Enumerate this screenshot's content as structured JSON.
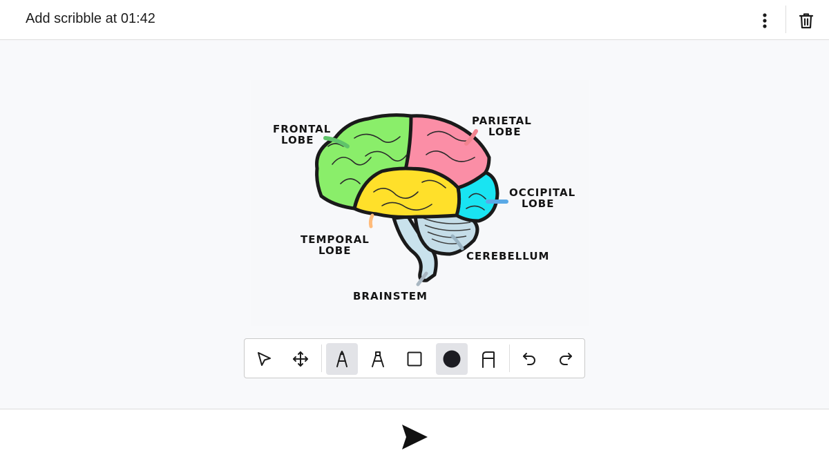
{
  "header": {
    "title": "Add scribble at 01:42",
    "more_icon": "vertical-dots-icon",
    "delete_icon": "trash-icon"
  },
  "image": {
    "labels": {
      "frontal_line1": "FRONTAL",
      "frontal_line2": "LOBE",
      "parietal_line1": "PARIETAL",
      "parietal_line2": "LOBE",
      "occipital_line1": "OCCIPITAL",
      "occipital_line2": "LOBE",
      "temporal_line1": "TEMPORAL",
      "temporal_line2": "LOBE",
      "cerebellum": "CEREBELLUM",
      "brainstem": "BRAINSTEM"
    },
    "colors": {
      "frontal": "#8aee6a",
      "parietal": "#fb8ea6",
      "occipital": "#19e4f2",
      "temporal": "#ffe02a",
      "cerebellum": "#c5dde8",
      "brainstem": "#c9e2ec",
      "outline": "#1a1a1a"
    }
  },
  "toolbar": {
    "tools": [
      {
        "name": "select",
        "icon": "pointer-arrow-icon",
        "active": false
      },
      {
        "name": "move",
        "icon": "move-arrows-icon",
        "active": false
      },
      {
        "name": "pen",
        "icon": "pen-tool-icon",
        "active": true
      },
      {
        "name": "highlighter",
        "icon": "highlighter-icon",
        "active": false
      },
      {
        "name": "rectangle",
        "icon": "square-icon",
        "active": false
      },
      {
        "name": "color",
        "icon": "color-dot-icon",
        "active": true
      },
      {
        "name": "stroke",
        "icon": "stroke-width-icon",
        "active": false
      },
      {
        "name": "undo",
        "icon": "undo-icon",
        "active": false
      },
      {
        "name": "redo",
        "icon": "redo-icon",
        "active": false
      }
    ],
    "selected_color": "#1c1c22"
  },
  "footer": {
    "send_icon": "send-icon"
  }
}
